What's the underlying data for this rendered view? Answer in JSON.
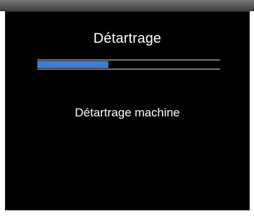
{
  "screen": {
    "title": "Détartrage",
    "message": "Détartrage machine",
    "progress": {
      "fraction": 0.39,
      "color": "#3b7fd9"
    }
  }
}
